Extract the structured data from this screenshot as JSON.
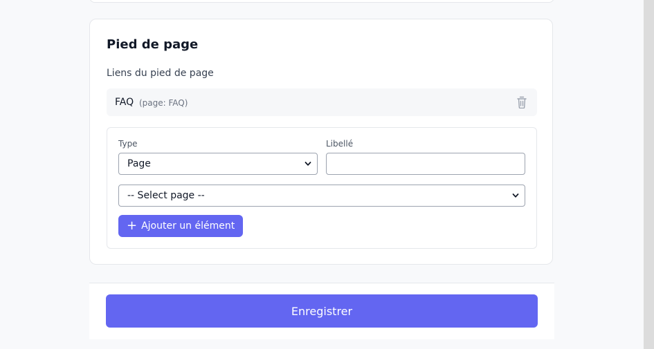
{
  "footer_section": {
    "title": "Pied de page",
    "links_label": "Liens du pied de page",
    "links": [
      {
        "label": "FAQ",
        "meta": "(page: FAQ)"
      }
    ],
    "form": {
      "type_label": "Type",
      "type_value": "Page",
      "label_label": "Libellé",
      "label_value": "",
      "page_select_value": "-- Select page --",
      "add_button": "Ajouter un élément"
    }
  },
  "actions": {
    "save_label": "Enregistrer"
  },
  "colors": {
    "accent": "#6366f1",
    "border": "#e5e7eb",
    "background": "#f8f9fb"
  },
  "icons": {
    "delete": "trash-icon",
    "add": "plus-icon",
    "dropdown": "chevron-down-icon"
  }
}
